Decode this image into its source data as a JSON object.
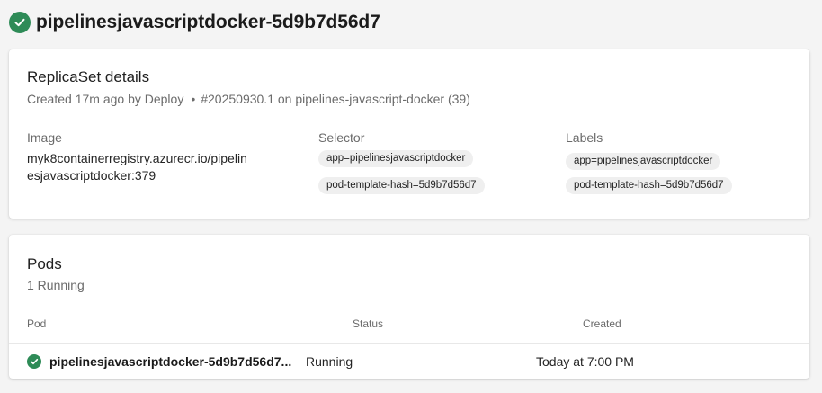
{
  "header": {
    "title": "pipelinesjavascriptdocker-5d9b7d56d7",
    "status_icon": "check-circle-icon"
  },
  "details": {
    "title": "ReplicaSet details",
    "created": "Created 17m ago by Deploy",
    "separator": "•",
    "run": "#20250930.1 on pipelines-javascript-docker (39)",
    "image_label": "Image",
    "image_value_line1": "myk8containerregistry.azurecr.io/pipelin",
    "image_value_line2": "esjavascriptdocker:379",
    "selector_label": "Selector",
    "selectors": [
      "app=pipelinesjavascriptdocker",
      "pod-template-hash=5d9b7d56d7"
    ],
    "labels_label": "Labels",
    "labels": [
      "app=pipelinesjavascriptdocker",
      "pod-template-hash=5d9b7d56d7"
    ]
  },
  "pods": {
    "title": "Pods",
    "summary": "1 Running",
    "columns": {
      "pod": "Pod",
      "status": "Status",
      "created": "Created"
    },
    "rows": [
      {
        "name": "pipelinesjavascriptdocker-5d9b7d56d7...",
        "status": "Running",
        "created": "Today at 7:00 PM",
        "status_icon": "check-circle-icon"
      }
    ]
  },
  "colors": {
    "success": "#2e8b57",
    "background": "#f4f4f4",
    "card": "#ffffff",
    "secondary_text": "#6b6b6b"
  }
}
